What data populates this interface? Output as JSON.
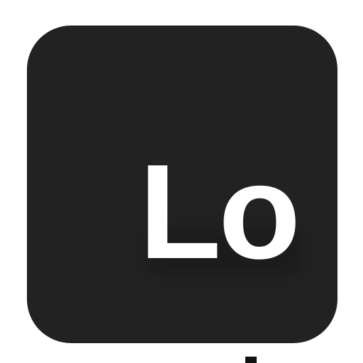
{
  "app_icon": {
    "label": "Lo",
    "colors": {
      "tile": "#222222",
      "glyph": "#ffffff",
      "background": "#ffffff"
    }
  }
}
